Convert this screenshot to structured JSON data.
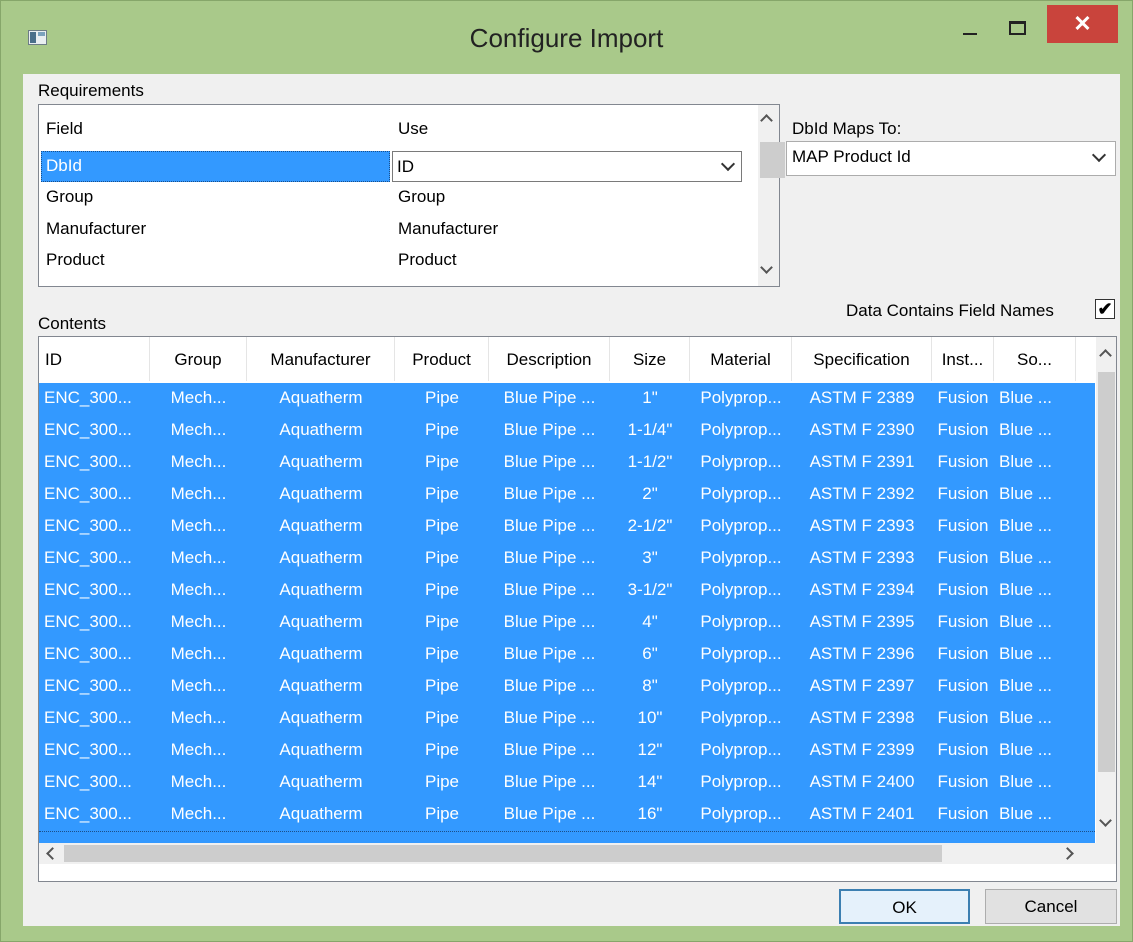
{
  "window": {
    "title": "Configure Import"
  },
  "title_buttons": {
    "minimize": "–",
    "maximize": "□",
    "close": "✕"
  },
  "requirements": {
    "label": "Requirements",
    "columns": [
      "Field",
      "Use"
    ],
    "rows": [
      {
        "field": "DbId",
        "use": "ID"
      },
      {
        "field": "Group",
        "use": "Group"
      },
      {
        "field": "Manufacturer",
        "use": "Manufacturer"
      },
      {
        "field": "Product",
        "use": "Product"
      }
    ]
  },
  "dbid_maps": {
    "label": "DbId Maps To:",
    "value": "MAP Product Id"
  },
  "contents": {
    "label": "Contents",
    "field_names_label": "Data Contains Field Names",
    "field_names_checked": true,
    "columns": [
      "ID",
      "Group",
      "Manufacturer",
      "Product",
      "Description",
      "Size",
      "Material",
      "Specification",
      "Inst...",
      "So..."
    ],
    "rows": [
      [
        "ENC_300...",
        "Mech...",
        "Aquatherm",
        "Pipe",
        "Blue Pipe ...",
        "1\"",
        "Polyprop...",
        "ASTM F 2389",
        "Fusion",
        "Blue ..."
      ],
      [
        "ENC_300...",
        "Mech...",
        "Aquatherm",
        "Pipe",
        "Blue Pipe ...",
        "1-1/4\"",
        "Polyprop...",
        "ASTM F 2390",
        "Fusion",
        "Blue ..."
      ],
      [
        "ENC_300...",
        "Mech...",
        "Aquatherm",
        "Pipe",
        "Blue Pipe ...",
        "1-1/2\"",
        "Polyprop...",
        "ASTM F 2391",
        "Fusion",
        "Blue ..."
      ],
      [
        "ENC_300...",
        "Mech...",
        "Aquatherm",
        "Pipe",
        "Blue Pipe ...",
        "2\"",
        "Polyprop...",
        "ASTM F 2392",
        "Fusion",
        "Blue ..."
      ],
      [
        "ENC_300...",
        "Mech...",
        "Aquatherm",
        "Pipe",
        "Blue Pipe ...",
        "2-1/2\"",
        "Polyprop...",
        "ASTM F 2393",
        "Fusion",
        "Blue ..."
      ],
      [
        "ENC_300...",
        "Mech...",
        "Aquatherm",
        "Pipe",
        "Blue Pipe ...",
        "3\"",
        "Polyprop...",
        "ASTM F 2393",
        "Fusion",
        "Blue ..."
      ],
      [
        "ENC_300...",
        "Mech...",
        "Aquatherm",
        "Pipe",
        "Blue Pipe ...",
        "3-1/2\"",
        "Polyprop...",
        "ASTM F 2394",
        "Fusion",
        "Blue ..."
      ],
      [
        "ENC_300...",
        "Mech...",
        "Aquatherm",
        "Pipe",
        "Blue Pipe ...",
        "4\"",
        "Polyprop...",
        "ASTM F 2395",
        "Fusion",
        "Blue ..."
      ],
      [
        "ENC_300...",
        "Mech...",
        "Aquatherm",
        "Pipe",
        "Blue Pipe ...",
        "6\"",
        "Polyprop...",
        "ASTM F 2396",
        "Fusion",
        "Blue ..."
      ],
      [
        "ENC_300...",
        "Mech...",
        "Aquatherm",
        "Pipe",
        "Blue Pipe ...",
        "8\"",
        "Polyprop...",
        "ASTM F 2397",
        "Fusion",
        "Blue ..."
      ],
      [
        "ENC_300...",
        "Mech...",
        "Aquatherm",
        "Pipe",
        "Blue Pipe ...",
        "10\"",
        "Polyprop...",
        "ASTM F 2398",
        "Fusion",
        "Blue ..."
      ],
      [
        "ENC_300...",
        "Mech...",
        "Aquatherm",
        "Pipe",
        "Blue Pipe ...",
        "12\"",
        "Polyprop...",
        "ASTM F 2399",
        "Fusion",
        "Blue ..."
      ],
      [
        "ENC_300...",
        "Mech...",
        "Aquatherm",
        "Pipe",
        "Blue Pipe ...",
        "14\"",
        "Polyprop...",
        "ASTM F 2400",
        "Fusion",
        "Blue ..."
      ],
      [
        "ENC_300...",
        "Mech...",
        "Aquatherm",
        "Pipe",
        "Blue Pipe ...",
        "16\"",
        "Polyprop...",
        "ASTM F 2401",
        "Fusion",
        "Blue ..."
      ]
    ]
  },
  "buttons": {
    "ok": "OK",
    "cancel": "Cancel"
  },
  "colors": {
    "titlebar": "#a9c98a",
    "selection": "#3399ff",
    "close": "#c9443c"
  }
}
